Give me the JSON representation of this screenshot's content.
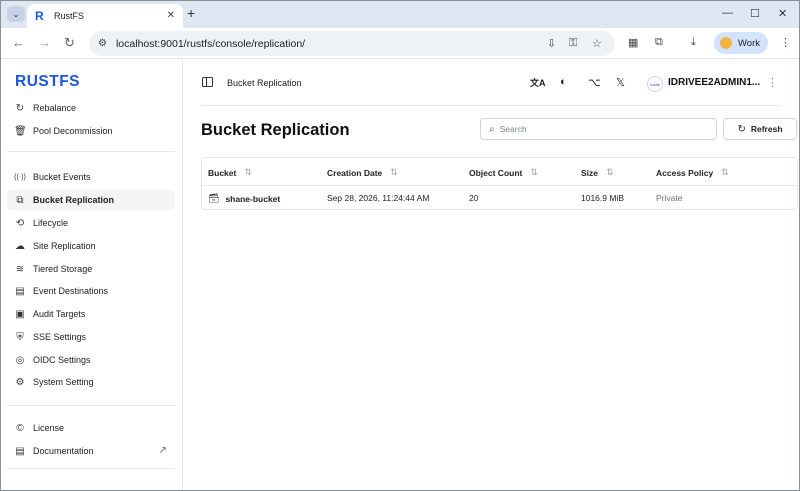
{
  "browser": {
    "tab": {
      "favicon": "R",
      "title": "RustFS",
      "close_icon": "✕"
    },
    "new_tab_icon": "+",
    "window_controls": {
      "minimize": "—",
      "maximize": "☐",
      "close": "✕"
    },
    "nav": {
      "back": "←",
      "forward": "→",
      "reload": "↻"
    },
    "url": "localhost:9001/rustfs/console/replication/",
    "profile_label": "Work",
    "menu_icon": "⋮"
  },
  "sidebar": {
    "logo": "RUSTFS",
    "items_top": [
      {
        "label": "Rebalance",
        "icon": "↻"
      },
      {
        "label": "Pool Decommission",
        "icon": "🗑"
      }
    ],
    "items_main": [
      {
        "label": "Bucket Events",
        "icon": "((·))"
      },
      {
        "label": "Bucket Replication",
        "icon": "⧉",
        "active": true
      },
      {
        "label": "Lifecycle",
        "icon": "⟲"
      },
      {
        "label": "Site Replication",
        "icon": "☁"
      },
      {
        "label": "Tiered Storage",
        "icon": "≋"
      },
      {
        "label": "Event Destinations",
        "icon": "▤"
      },
      {
        "label": "Audit Targets",
        "icon": "▣"
      },
      {
        "label": "SSE Settings",
        "icon": "⛨"
      },
      {
        "label": "OIDC Settings",
        "icon": "◎"
      },
      {
        "label": "System Setting",
        "icon": "⚙"
      }
    ],
    "items_bottom": [
      {
        "label": "License",
        "icon": "©"
      },
      {
        "label": "Documentation",
        "icon": "▤",
        "external_icon": "↗"
      }
    ]
  },
  "header": {
    "breadcrumb": "Bucket Replication",
    "icons": {
      "translate": "文A",
      "theme": "◐",
      "github": "⌥",
      "x": "𝕏"
    },
    "user_logo": "rustfs",
    "user_name": "IDRIVEE2ADMIN1...",
    "more_icon": "⋮"
  },
  "main": {
    "title": "Bucket Replication",
    "search_placeholder": "Search",
    "refresh_label": "Refresh",
    "table": {
      "columns": [
        "Bucket",
        "Creation Date",
        "Object Count",
        "Size",
        "Access Policy"
      ],
      "sort_icon": "⇅",
      "rows": [
        {
          "bucket": "shane-bucket",
          "created": "Sep 28, 2026, 11:24:44 AM",
          "objects": "20",
          "size": "1016.9 MiB",
          "policy": "Private"
        }
      ]
    }
  }
}
